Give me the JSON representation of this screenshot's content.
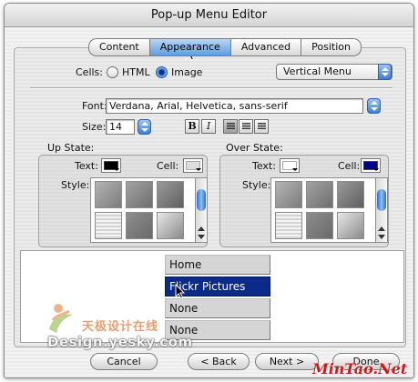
{
  "window": {
    "title": "Pop-up Menu Editor"
  },
  "tabs": [
    {
      "label": "Content",
      "active": false
    },
    {
      "label": "Appearance",
      "active": true
    },
    {
      "label": "Advanced",
      "active": false
    },
    {
      "label": "Position",
      "active": false
    }
  ],
  "cells": {
    "label": "Cells:",
    "options": [
      {
        "label": "HTML",
        "checked": false
      },
      {
        "label": "Image",
        "checked": true
      }
    ],
    "orientation": "Vertical Menu"
  },
  "font": {
    "label": "Font:",
    "value": "Verdana, Arial, Helvetica, sans-serif"
  },
  "size": {
    "label": "Size:",
    "value": "14"
  },
  "format": {
    "bold": "B",
    "italic": "I",
    "align_selected": "left"
  },
  "up_state": {
    "title": "Up State:",
    "text_label": "Text:",
    "text_color": "#000000",
    "cell_label": "Cell:",
    "cell_color": "#dddddd",
    "style_label": "Style:"
  },
  "over_state": {
    "title": "Over State:",
    "text_label": "Text:",
    "text_color": "#ffffff",
    "cell_label": "Cell:",
    "cell_color": "#00008b",
    "style_label": "Style:"
  },
  "preview": {
    "items": [
      "Home",
      "Flickr Pictures",
      "None",
      "None"
    ],
    "selected_index": 1
  },
  "buttons": {
    "cancel": "Cancel",
    "back": "< Back",
    "next": "Next >",
    "done": "Done"
  },
  "watermarks": {
    "cn": "天极设计在线",
    "site": "Design.yesky.com",
    "signature": "MinTao.Net"
  },
  "colors": {
    "accent": "#3c7fd8",
    "selection": "#0b2a8a"
  },
  "icons": [
    "radio-icon",
    "popup-arrows-icon",
    "stepper-icon",
    "align-left-icon",
    "align-center-icon",
    "align-right-icon",
    "scroll-arrow-icon",
    "mouse-pointer-icon"
  ]
}
